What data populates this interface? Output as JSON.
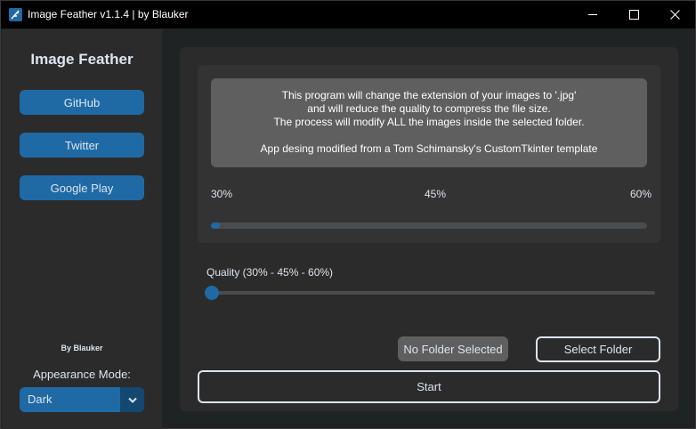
{
  "window": {
    "title": "Image Feather v1.1.4 | by Blauker",
    "icon": "feather-app-icon"
  },
  "sidebar": {
    "title": "Image Feather",
    "buttons": [
      {
        "label": "GitHub"
      },
      {
        "label": "Twitter"
      },
      {
        "label": "Google Play"
      }
    ],
    "by_label": "By Blauker",
    "appearance_label": "Appearance Mode:",
    "appearance_value": "Dark"
  },
  "info": {
    "lines": [
      "This program will change the extension of your images to '.jpg'",
      "and will reduce the quality to compress the file size.",
      "The process will modify ALL the images inside the selected folder.",
      "App desing modified from a Tom Schimansky's CustomTkinter template"
    ]
  },
  "progress": {
    "labels": [
      "30%",
      "45%",
      "60%"
    ],
    "fraction": 0.02
  },
  "quality": {
    "label": "Quality (30% - 45% - 60%)",
    "slider_fraction": 0.0
  },
  "folder": {
    "status": "No Folder Selected",
    "select_label": "Select Folder"
  },
  "start_label": "Start",
  "colors": {
    "accent": "#1f6aa5",
    "background": "#202324",
    "panel": "#2b2b2b",
    "text": "#dce4ee"
  }
}
